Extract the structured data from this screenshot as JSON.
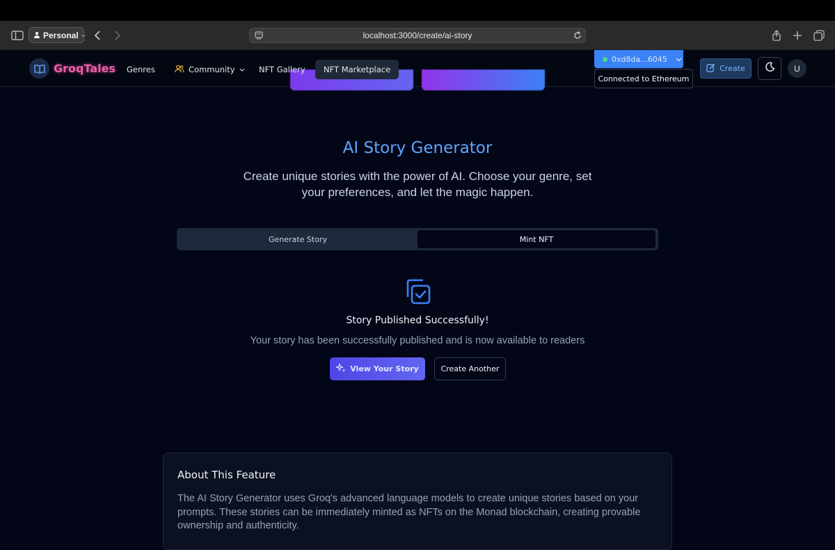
{
  "browser": {
    "profile_label": "Personal",
    "url": "localhost:3000/create/ai-story"
  },
  "nav": {
    "brand": "GroqTales",
    "links": [
      "Genres",
      "Community",
      "NFT Gallery",
      "NFT Marketplace"
    ],
    "wallet_address": "0xd8da...6045",
    "wallet_tooltip": "Connected to Ethereum",
    "create_label": "Create",
    "avatar_initial": "U"
  },
  "hero": {
    "title": "AI Story Generator",
    "subtitle": "Create unique stories with the power of AI. Choose your genre, set your preferences, and let the magic happen."
  },
  "tabs": {
    "generate": "Generate Story",
    "mint": "Mint NFT",
    "active": "mint"
  },
  "result": {
    "title": "Story Published Successfully!",
    "description": "Your story has been successfully published and is now available to readers",
    "view_button": "View Your Story",
    "another_button": "Create Another"
  },
  "about": {
    "heading": "About This Feature",
    "body": "The AI Story Generator uses Groq's advanced language models to create unique stories based on your prompts. These stories can be immediately minted as NFTs on the Monad blockchain, creating provable ownership and authenticity."
  },
  "colors": {
    "accent": "#60a5fa",
    "brand": "#ec5ea8",
    "primary_button": "#5b5ef0",
    "background": "#020617"
  }
}
